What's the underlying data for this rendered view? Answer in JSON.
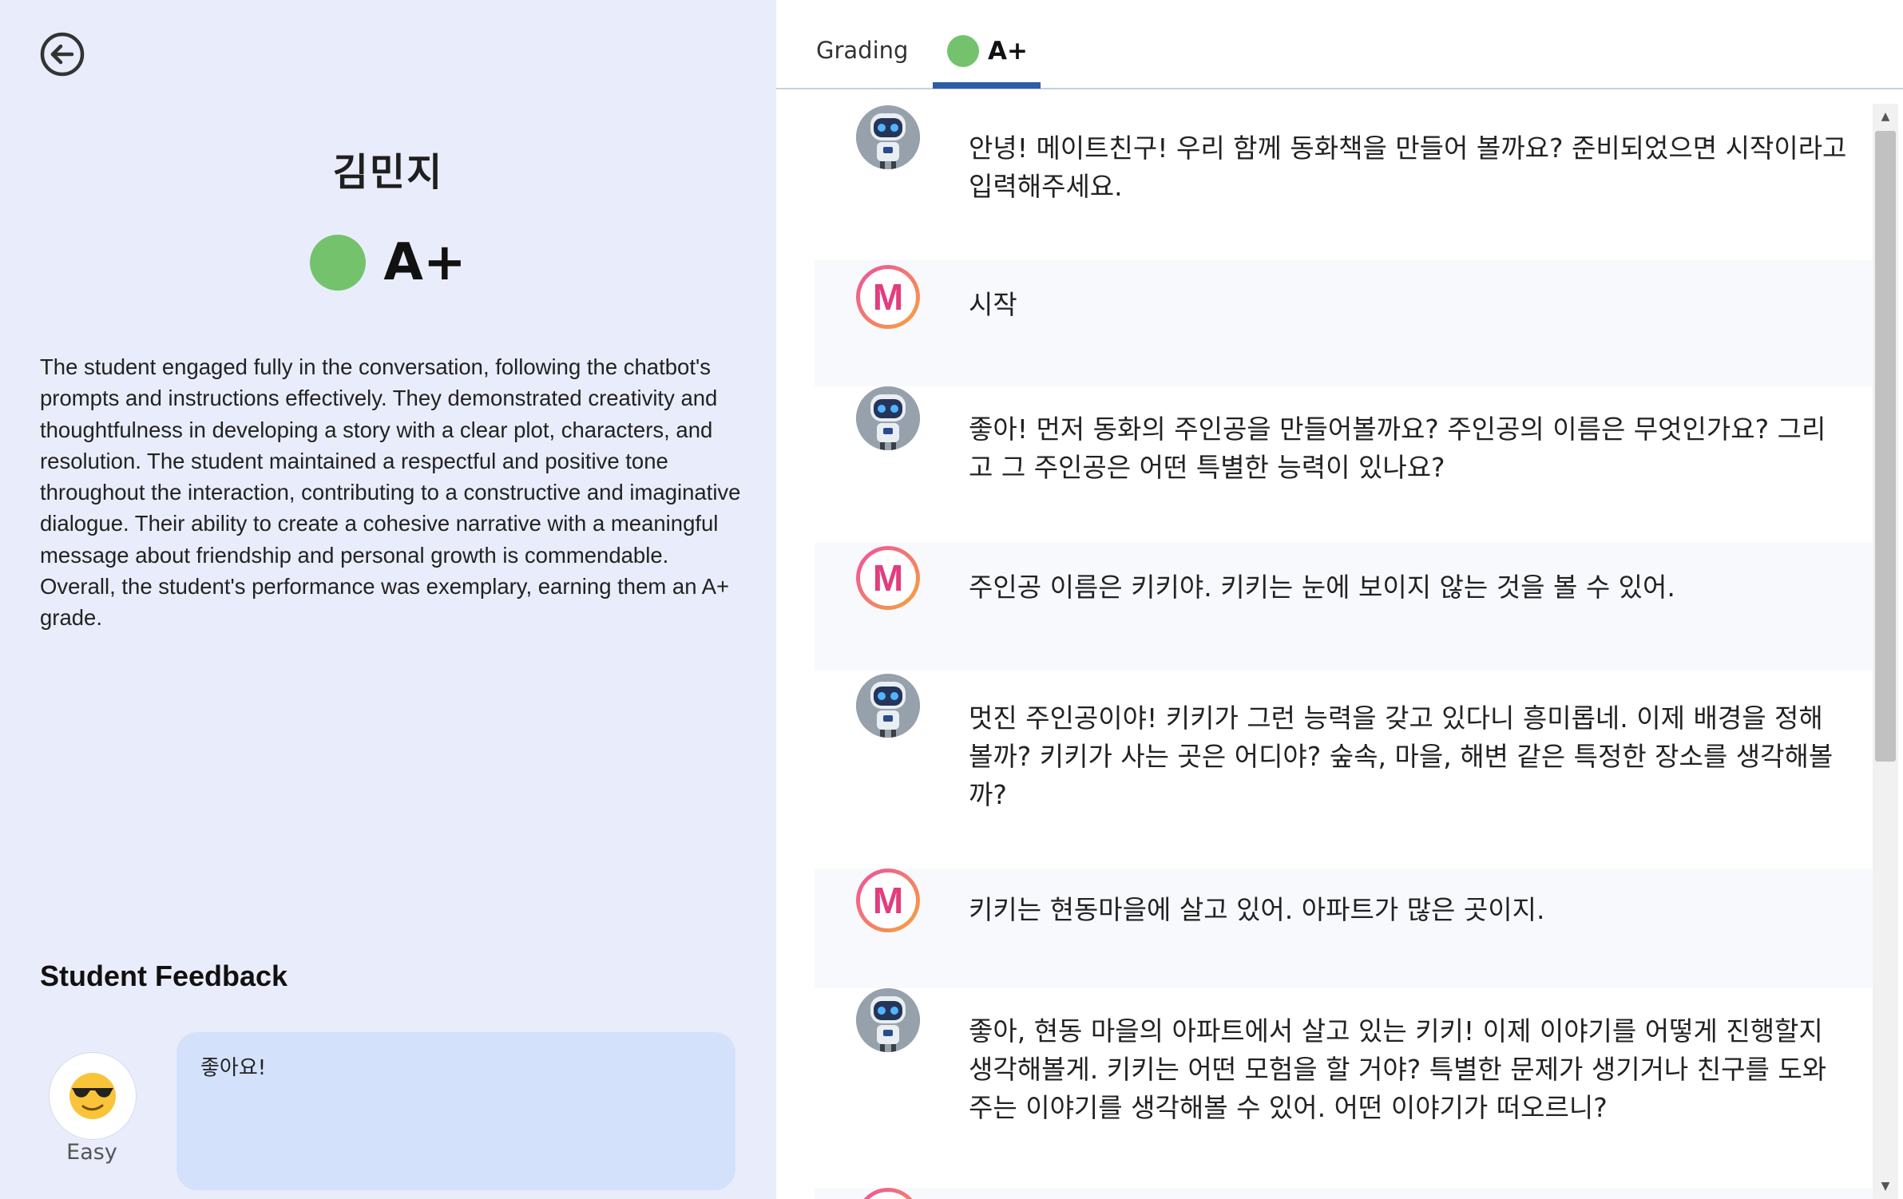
{
  "student": {
    "name": "김민지",
    "grade": "A+",
    "grade_color": "#74c36c",
    "summary": "The student engaged fully in the conversation, following the chatbot's prompts and instructions effectively. They demonstrated creativity and thoughtfulness in developing a story with a clear plot, characters, and resolution. The student maintained a respectful and positive tone throughout the interaction, contributing to a constructive and imaginative dialogue. Their ability to create a cohesive narrative with a meaningful message about friendship and personal growth is commendable. Overall, the student's performance was exemplary, earning them an A+ grade."
  },
  "feedback": {
    "title": "Student Feedback",
    "emoji": "😎",
    "difficulty": "Easy",
    "text": "좋아요!"
  },
  "tabs": {
    "grading_label": "Grading",
    "grade_label": "A+",
    "active_color": "#2f5da5"
  },
  "messages": [
    {
      "role": "bot",
      "text": "안녕! 메이트친구! 우리 함께 동화책을 만들어 볼까요? 준비되었으면 시작이라고 입력해주세요."
    },
    {
      "role": "user",
      "text": "시작"
    },
    {
      "role": "bot",
      "text": "좋아! 먼저 동화의 주인공을 만들어볼까요? 주인공의 이름은 무엇인가요? 그리고 그 주인공은 어떤 특별한 능력이 있나요?"
    },
    {
      "role": "user",
      "text": "주인공 이름은 키키야. 키키는 눈에 보이지 않는 것을 볼 수 있어."
    },
    {
      "role": "bot",
      "text": "멋진 주인공이야! 키키가 그런 능력을 갖고 있다니 흥미롭네. 이제 배경을 정해볼까? 키키가 사는 곳은 어디야? 숲속, 마을, 해변 같은 특정한 장소를 생각해볼까?"
    },
    {
      "role": "user",
      "text": "키키는 현동마을에 살고 있어. 아파트가 많은 곳이지."
    },
    {
      "role": "bot",
      "text": "좋아, 현동 마을의 아파트에서 살고 있는 키키! 이제 이야기를 어떻게 진행할지 생각해볼게. 키키는 어떤 모험을 할 거야? 특별한 문제가 생기거나 친구를 도와주는 이야기를 생각해볼 수 있어. 어떤 이야기가 떠오르니?"
    }
  ]
}
